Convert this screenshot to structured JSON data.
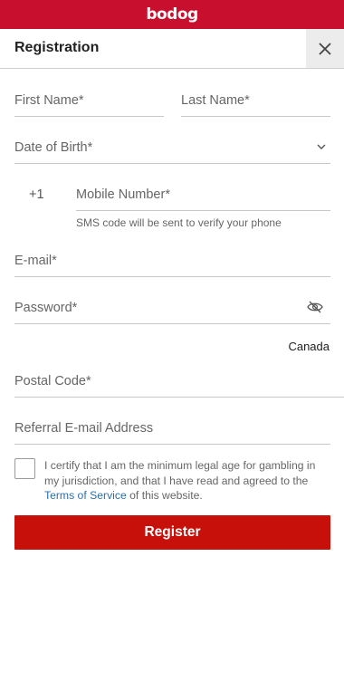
{
  "brand": {
    "logo_text": "bodog",
    "primary_color": "#c8102e"
  },
  "header": {
    "title": "Registration",
    "close_icon": "close-icon"
  },
  "form": {
    "first_name": {
      "placeholder": "First Name*",
      "value": ""
    },
    "last_name": {
      "placeholder": "Last Name*",
      "value": ""
    },
    "dob": {
      "placeholder": "Date of Birth*",
      "icon": "chevron-down-icon"
    },
    "phone": {
      "country_code": "+1",
      "placeholder": "Mobile Number*",
      "hint": "SMS code will be sent to verify your phone"
    },
    "email": {
      "placeholder": "E-mail*",
      "value": ""
    },
    "password": {
      "placeholder": "Password*",
      "icon": "eye-slash-icon"
    },
    "country": "Canada",
    "postal_code": {
      "placeholder": "Postal Code*",
      "value": ""
    },
    "referral": {
      "placeholder": "Referral E-mail Address",
      "value": ""
    },
    "terms": {
      "checked": false,
      "text_before": "I certify that I am the minimum legal age for gambling in my jurisdiction, and that I have read and agreed to the ",
      "link_text": "Terms of Service",
      "text_after": " of this website."
    },
    "submit_label": "Register"
  }
}
